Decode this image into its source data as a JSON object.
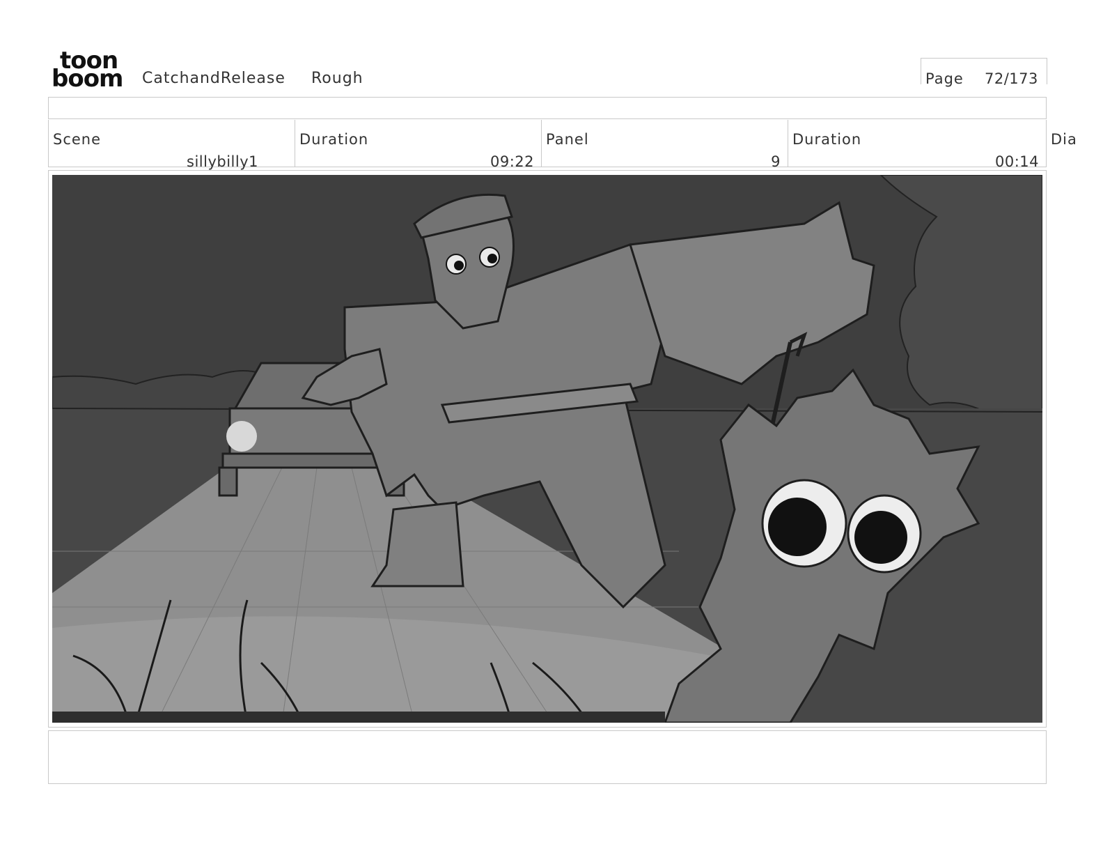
{
  "header": {
    "logo_top": "toon",
    "logo_bottom": "boom",
    "project_name": "CatchandRelease",
    "stage": "Rough",
    "page_label": "Page",
    "page_value": "72/173"
  },
  "info": {
    "scene_label": "Scene",
    "scene_value": "sillybilly1",
    "scene_duration_label": "Duration",
    "scene_duration_value": "09:22",
    "panel_label": "Panel",
    "panel_value": "9",
    "panel_duration_label": "Duration",
    "panel_duration_value": "00:14",
    "dialogue_label": "Dia"
  },
  "notes": {
    "text": ""
  }
}
